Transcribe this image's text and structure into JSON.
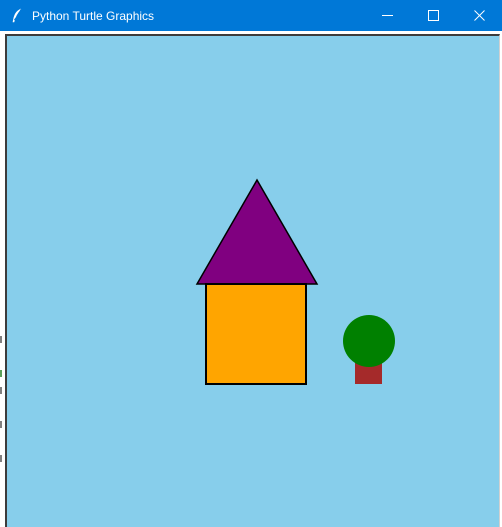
{
  "window": {
    "title": "Python Turtle Graphics",
    "titlebar_color": "#0078d7",
    "icons": {
      "app": "feather-icon",
      "minimize": "minimize-icon",
      "maximize": "maximize-icon",
      "close": "close-icon"
    }
  },
  "canvas": {
    "background": "#87ceeb",
    "drawing": {
      "house_roof": {
        "fill": "#800080",
        "outline": "#000000"
      },
      "house_body": {
        "fill": "#ffa500",
        "outline": "#000000"
      },
      "tree_trunk": {
        "fill": "#a52a2a"
      },
      "tree_crown": {
        "fill": "#008000"
      }
    }
  }
}
